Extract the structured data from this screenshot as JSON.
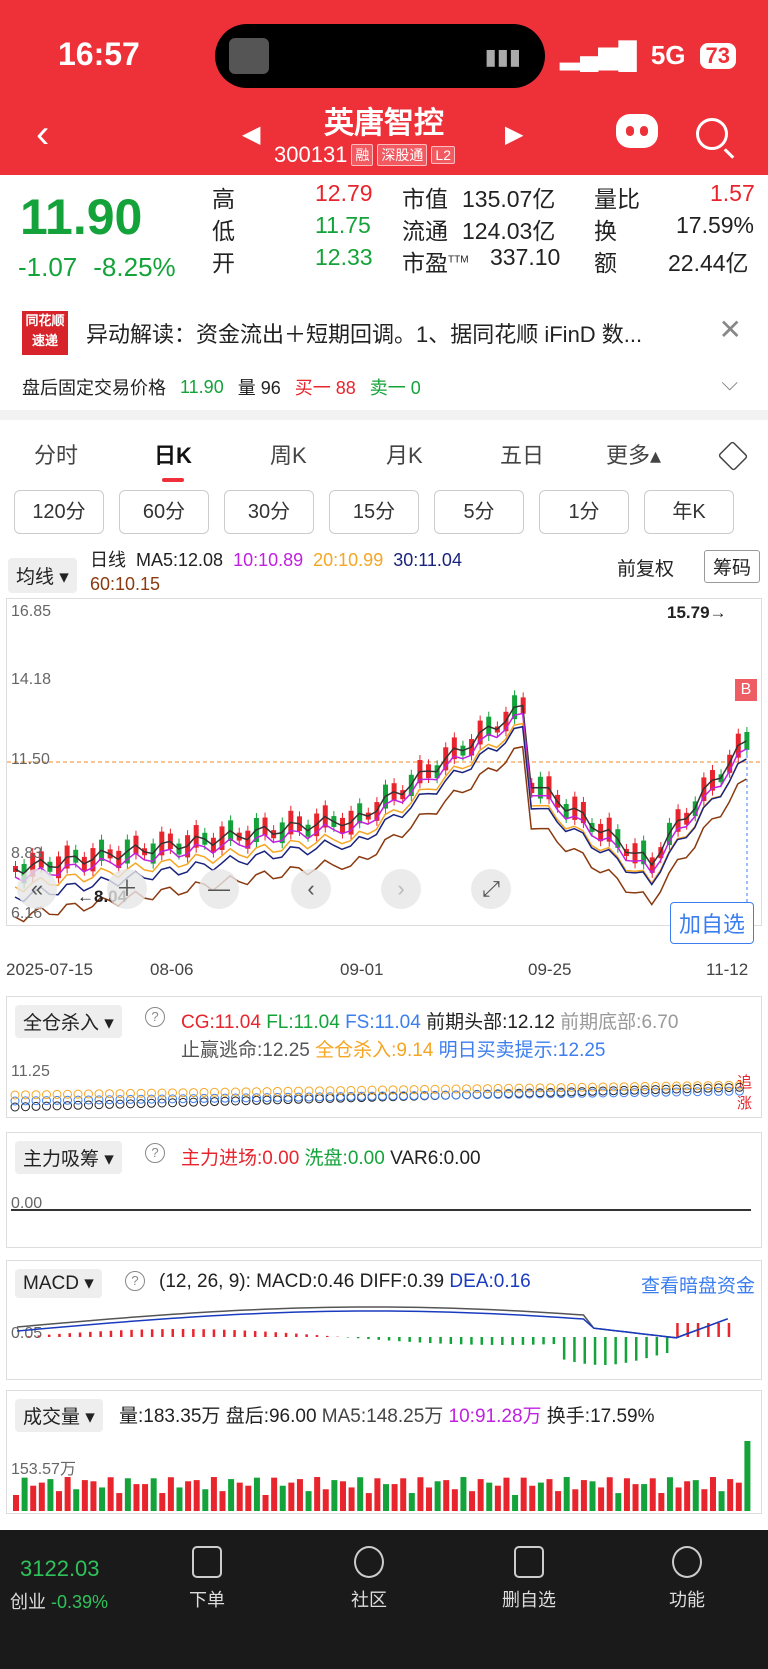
{
  "status": {
    "time": "16:57",
    "network": "5G",
    "battery": "73"
  },
  "header": {
    "title": "英唐智控",
    "code": "300131",
    "tags": [
      "融",
      "深股通",
      "L2"
    ]
  },
  "quote": {
    "price": "11.90",
    "change": "-1.07",
    "change_pct": "-8.25%",
    "high_label": "高",
    "high": "12.79",
    "low_label": "低",
    "low": "11.75",
    "open_label": "开",
    "open": "12.33",
    "mcap_label": "市值",
    "mcap": "135.07亿",
    "float_label": "流通",
    "float": "124.03亿",
    "pe_label": "市盈",
    "pe_sup": "TTM",
    "pe": "337.10",
    "vr_label": "量比",
    "vr": "1.57",
    "turn_label": "换",
    "turn": "17.59%",
    "amt_label": "额",
    "amt": "22.44亿"
  },
  "news": {
    "logo_top": "同花顺",
    "logo_bottom": "速递",
    "text": "异动解读：资金流出＋短期回调。1、据同花顺 iFinD 数..."
  },
  "afterhours": {
    "label": "盘后固定交易价格",
    "price": "11.90",
    "vol_label": "量",
    "vol": "96",
    "buy": "买一 88",
    "sell": "卖一 0"
  },
  "tabs": [
    "分时",
    "日K",
    "周K",
    "月K",
    "五日",
    "更多▴"
  ],
  "periods": [
    "120分",
    "60分",
    "30分",
    "15分",
    "5分",
    "1分",
    "年K"
  ],
  "ma": {
    "button": "均线 ▾",
    "label": "日线",
    "ma5": "MA5:12.08",
    "ma10": "10:10.89",
    "ma20": "20:10.99",
    "ma30": "30:11.04",
    "ma60": "60:10.15",
    "adjust": "前复权",
    "chips": "筹码"
  },
  "kline": {
    "y_labels": [
      "16.85",
      "14.18",
      "11.50",
      "8.83",
      "6.16"
    ],
    "max_label": "15.79→",
    "min_label": "←8.04",
    "buy_marker": "B",
    "dates": [
      "2025-07-15",
      "08-06",
      "09-01",
      "09-25",
      "11-12"
    ],
    "add_watch": "加自选",
    "colors": {
      "up": "#e8242c",
      "down": "#14a33a",
      "ma5": "#333333",
      "ma10": "#c020e0",
      "ma20": "#f5a623",
      "ma30": "#1a237e",
      "ma60": "#8b3a0f"
    }
  },
  "ind1": {
    "button": "全仓杀入 ▾",
    "cg": "CG:11.04",
    "fl": "FL:11.04",
    "fs": "FS:11.04",
    "prev_top": "前期头部:12.12",
    "prev_bottom": "前期底部:6.70",
    "stop": "止赢逃命:12.25",
    "allin": "全仓杀入:9.14",
    "tmr": "明日买卖提示:12.25",
    "y_label": "11.25",
    "tag": "追涨"
  },
  "ind2": {
    "button": "主力吸筹 ▾",
    "main_in": "主力进场:0.00",
    "wash": "洗盘:0.00",
    "var6": "VAR6:0.00",
    "y_label": "0.00"
  },
  "macd": {
    "button": "MACD ▾",
    "params": "(12, 26, 9):",
    "macd": "MACD:0.46",
    "diff": "DIFF:0.39",
    "dea": "DEA:0.16",
    "link": "查看暗盘资金",
    "y_label": "0.05"
  },
  "volume": {
    "button": "成交量 ▾",
    "vol": "量:183.35万",
    "after": "盘后:96.00",
    "ma5": "MA5:148.25万",
    "ma10": "10:91.28万",
    "turn": "换手:17.59%",
    "y_label": "153.57万"
  },
  "nav": {
    "index_val": "3122.03",
    "index_name": "创业",
    "index_chg": "-0.39%",
    "items": [
      "下单",
      "社区",
      "删自选",
      "功能"
    ]
  }
}
